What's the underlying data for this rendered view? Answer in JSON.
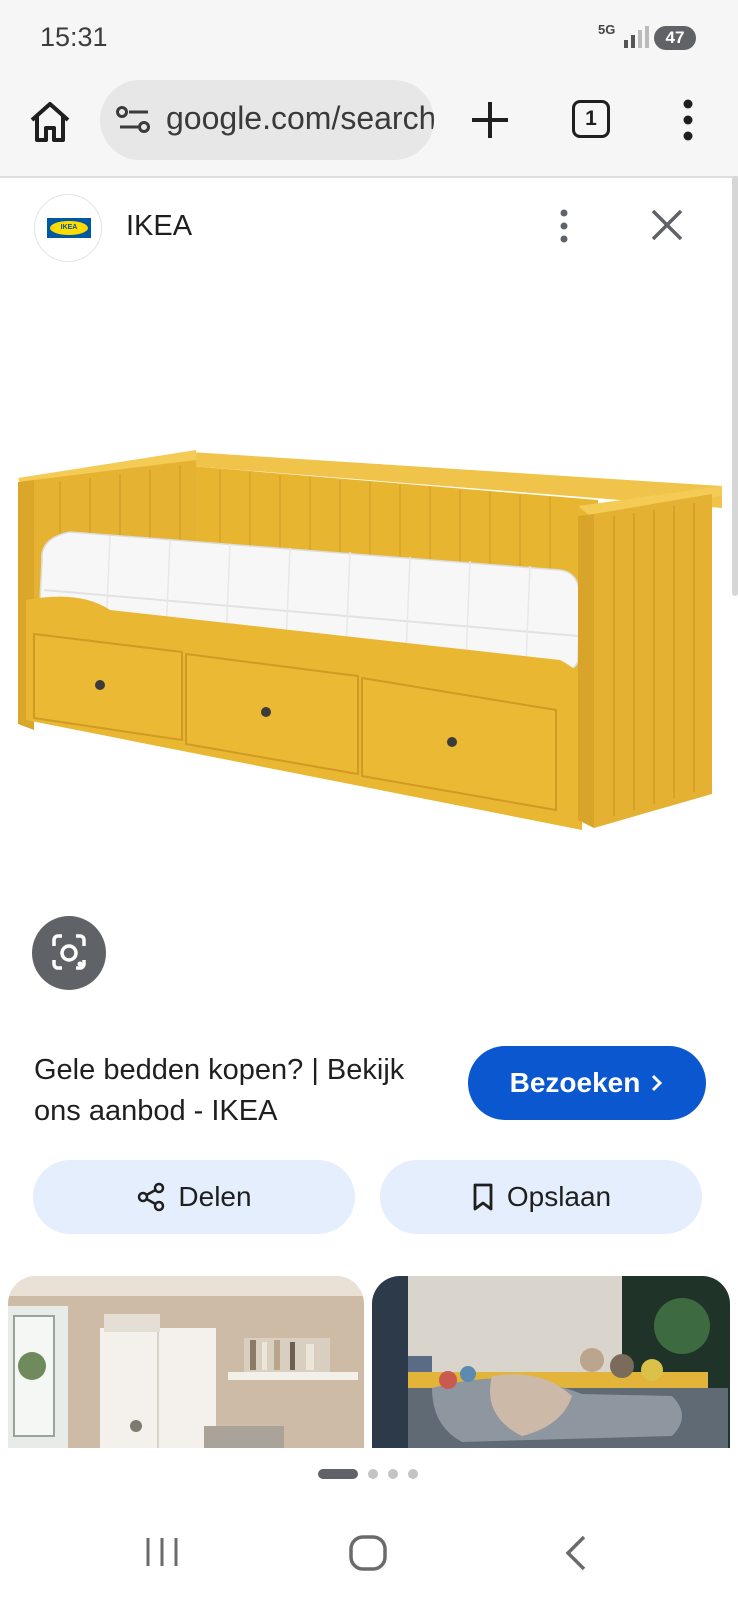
{
  "status_bar": {
    "time": "15:31",
    "network": "5G",
    "battery": "47"
  },
  "browser": {
    "url": "google.com/search",
    "tab_count": "1"
  },
  "panel": {
    "site_name": "IKEA",
    "logo_text": "IKEA",
    "result_title": "Gele bedden kopen? | Bekijk ons aanbod - IKEA",
    "visit_label": "Bezoeken",
    "share_label": "Delen",
    "save_label": "Opslaan"
  },
  "carousel": {
    "page_count": 4,
    "active_page": 1
  },
  "colors": {
    "accent": "#0b57d0",
    "chip_bg": "#e4eefc",
    "bed_yellow": "#e8b530"
  }
}
